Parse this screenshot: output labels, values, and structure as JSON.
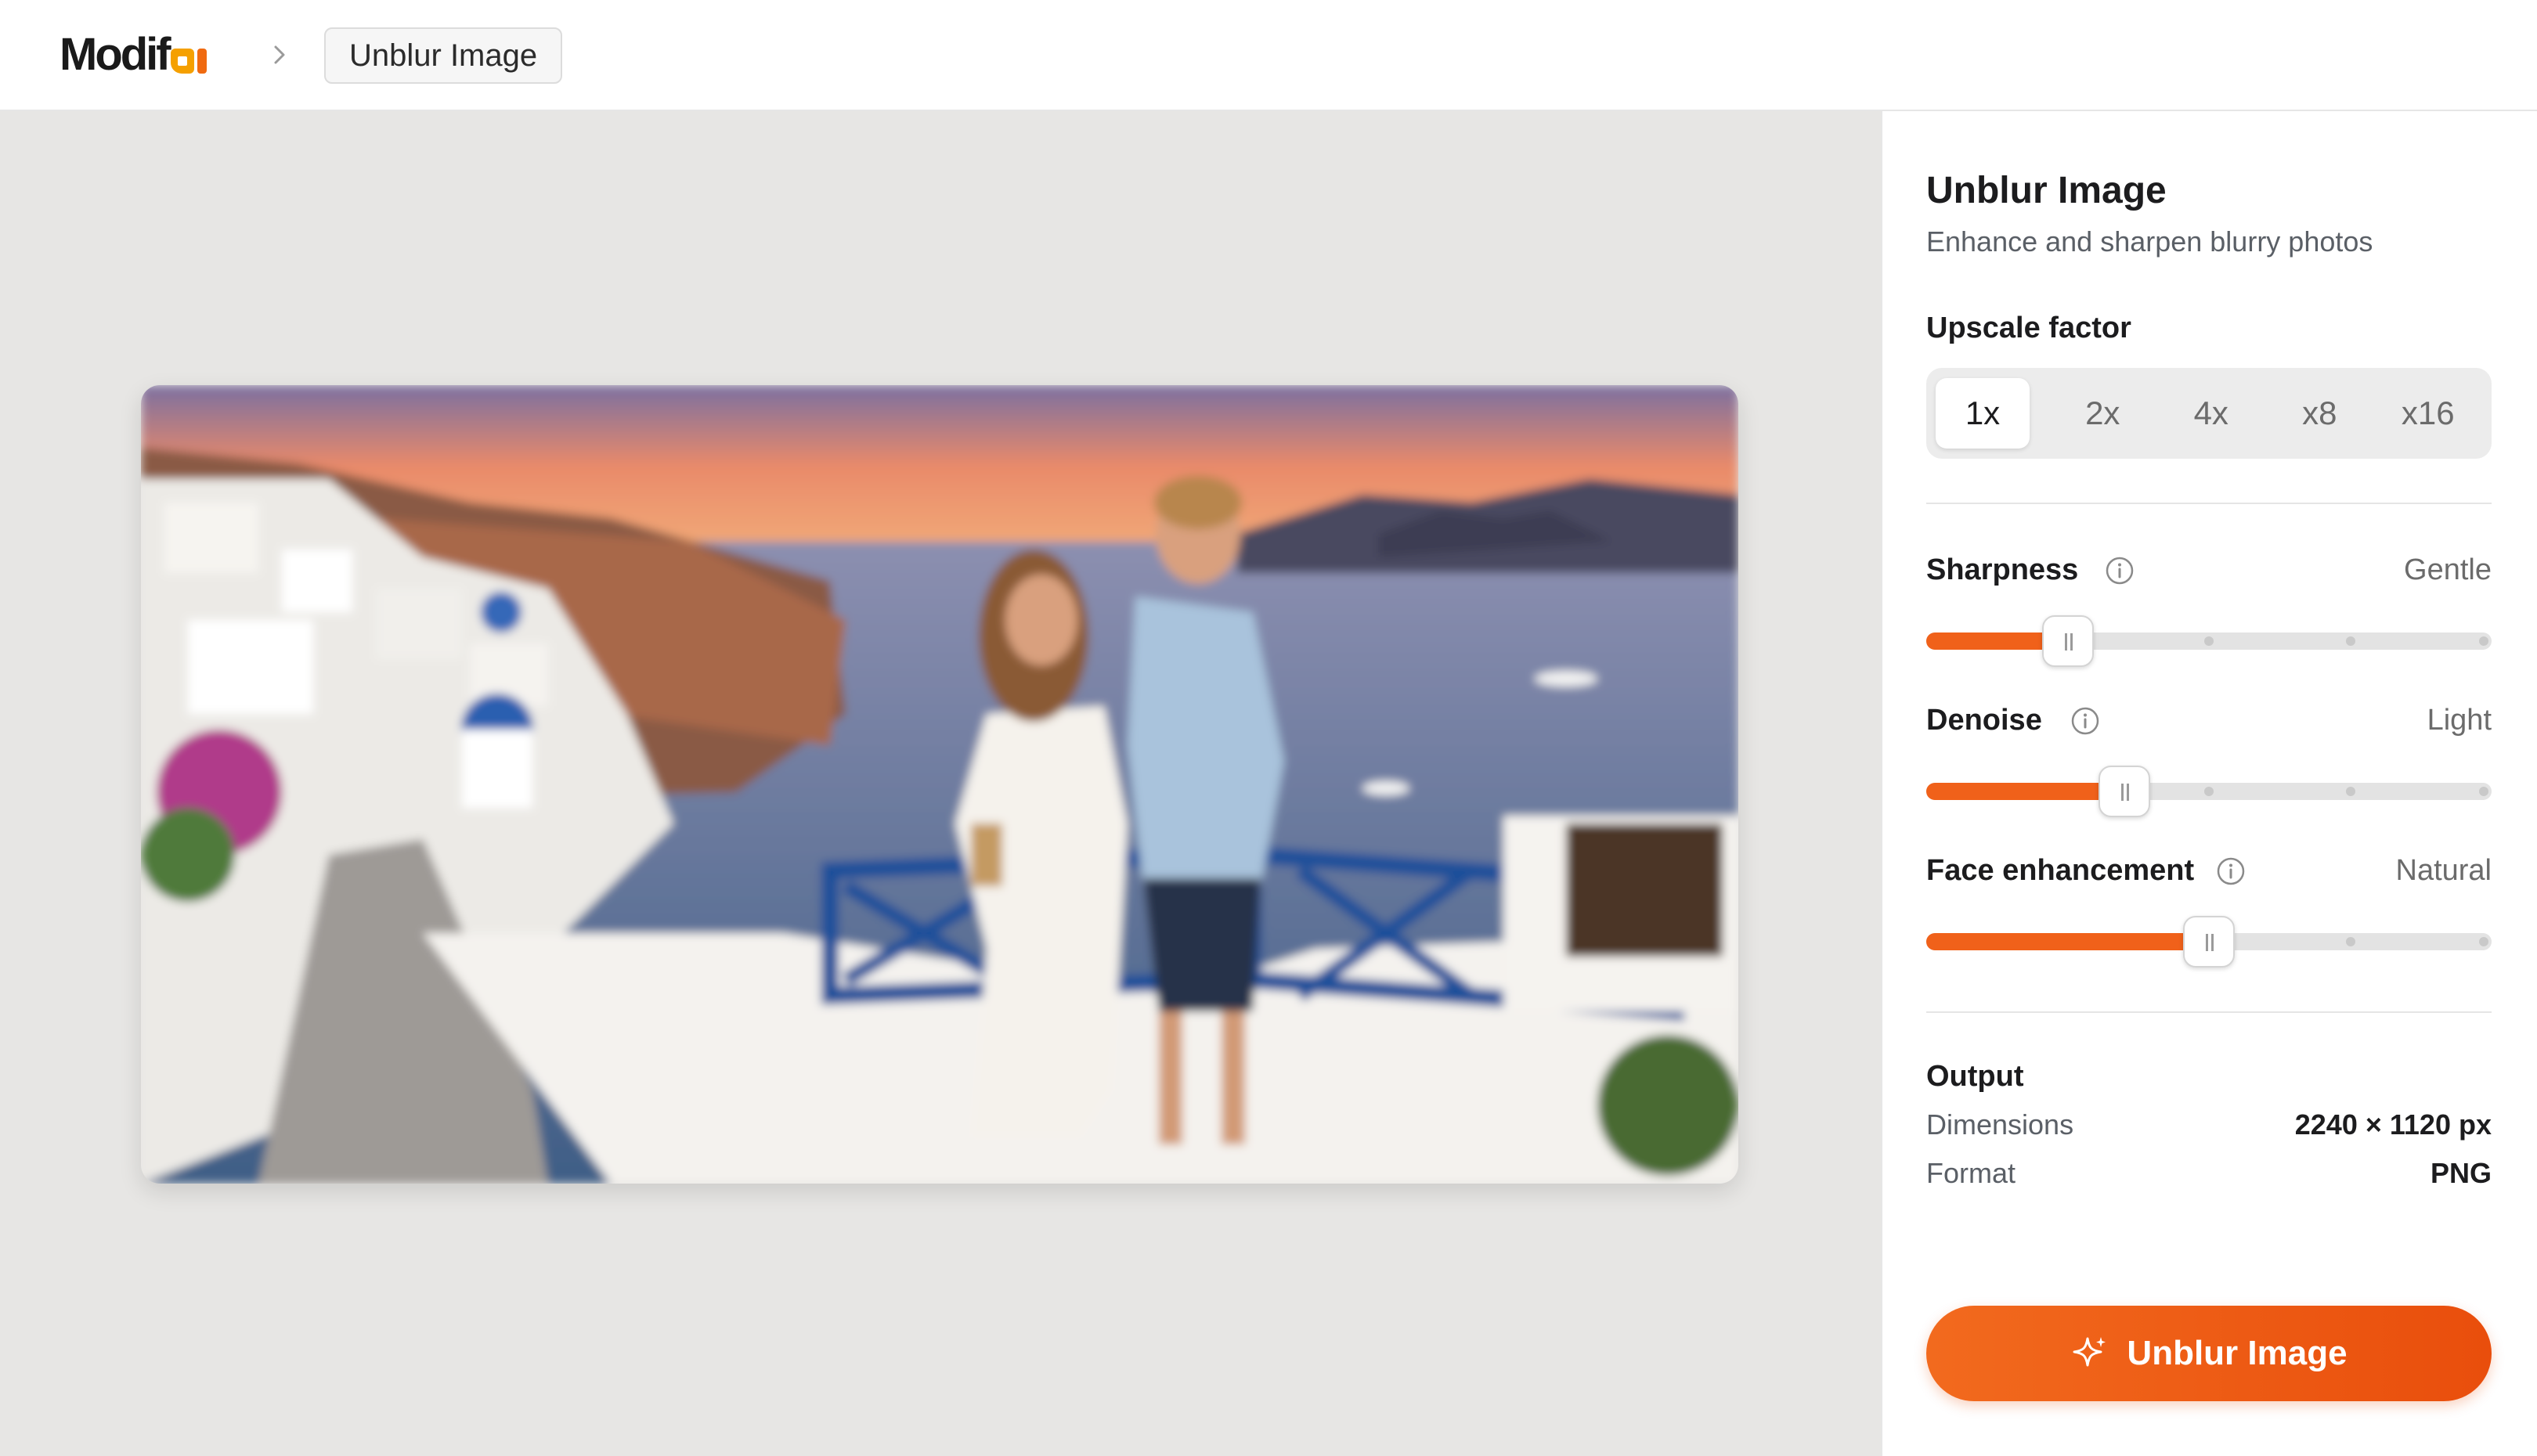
{
  "header": {
    "logo_text": "Modif",
    "logo_mark": "ai",
    "breadcrumb_separator_icon": "chevron-right-icon",
    "breadcrumb_current": "Unblur Image"
  },
  "canvas": {
    "image_alt": "Couple embracing on a terrace in Santorini at sunset (blurred)"
  },
  "panel": {
    "title": "Unblur Image",
    "subtitle": "Enhance and sharpen blurry photos",
    "upscale": {
      "label": "Upscale factor",
      "options": [
        "1x",
        "2x",
        "4x",
        "x8",
        "x16"
      ],
      "selected": "1x"
    },
    "sliders": [
      {
        "label": "Sharpness",
        "value_label": "Gentle",
        "level": 0.25
      },
      {
        "label": "Denoise",
        "value_label": "Light",
        "level": 0.35
      },
      {
        "label": "Face enhancement",
        "value_label": "Natural",
        "level": 0.5
      }
    ],
    "output": {
      "label": "Output",
      "dimensions_label": "Dimensions",
      "dimensions_value": "2240 × 1120 px",
      "format_label": "Format",
      "format_value": "PNG"
    },
    "cta_label": "Unblur Image"
  },
  "colors": {
    "accent": "#f0611a",
    "logo_yellow": "#f5a000",
    "canvas_bg": "#e7e6e4"
  }
}
